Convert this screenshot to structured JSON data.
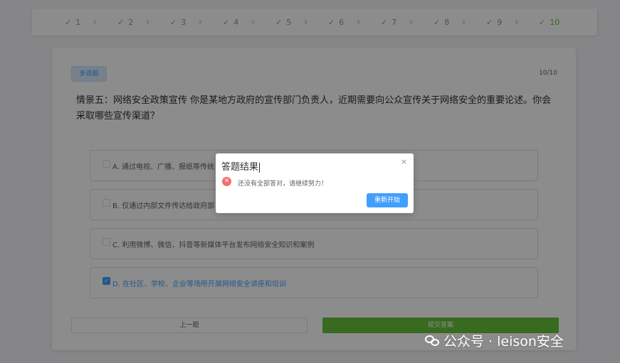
{
  "steps": [
    {
      "label": "1"
    },
    {
      "label": "2"
    },
    {
      "label": "3"
    },
    {
      "label": "4"
    },
    {
      "label": "5"
    },
    {
      "label": "6"
    },
    {
      "label": "7"
    },
    {
      "label": "8"
    },
    {
      "label": "9"
    },
    {
      "label": "10"
    }
  ],
  "question": {
    "type_tag": "多选题",
    "progress": "10/10",
    "text": "情景五：网络安全政策宣传 你是某地方政府的宣传部门负责人，近期需要向公众宣传关于网络安全的重要论述。你会采取哪些宣传渠道？",
    "options": [
      {
        "label": "A. 通过电视、广播、报纸等传统",
        "checked": false
      },
      {
        "label": "B. 仅通过内部文件传达给政府部",
        "checked": false
      },
      {
        "label": "C. 利用微博、微信、抖音等新媒体平台发布网络安全知识和案例",
        "checked": false
      },
      {
        "label": "D. 在社区、学校、企业等场所开展网络安全讲座和培训",
        "checked": true
      }
    ]
  },
  "buttons": {
    "prev": "上一题",
    "submit": "提交答案"
  },
  "dialog": {
    "title": "答题结果",
    "close_glyph": "×",
    "error_glyph": "✕",
    "message": "还没有全部答对，请继续努力！",
    "restart": "重新开始"
  },
  "watermark": {
    "text": "公众号 · leison安全"
  },
  "icons": {
    "step_check": "check-icon",
    "step_arrow": "chevron-right-icon",
    "dialog_close": "close-icon",
    "dialog_error": "error-circle-icon",
    "watermark": "wechat-icon"
  },
  "colors": {
    "primary": "#409eff",
    "success": "#67c23a",
    "danger": "#f56c6c"
  }
}
